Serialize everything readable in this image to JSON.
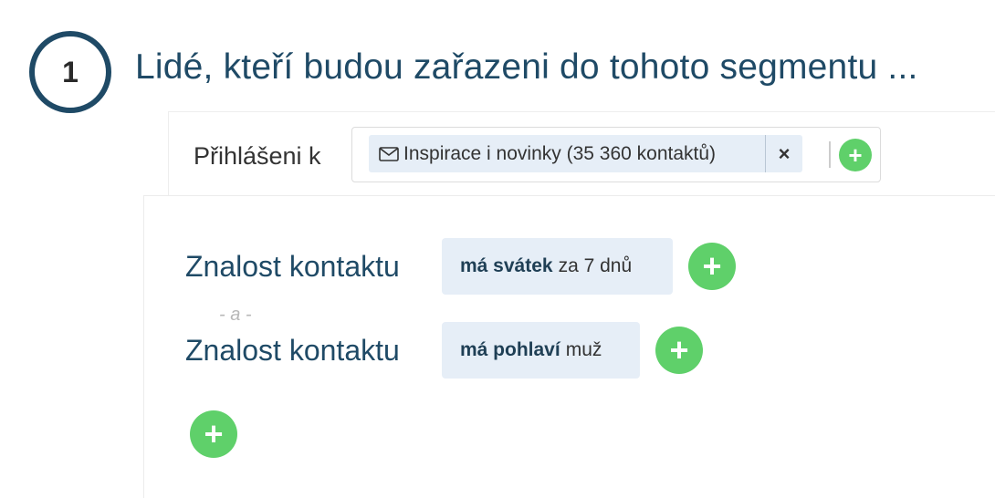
{
  "step": {
    "number": "1",
    "title": "Lidé, kteří budou zařazeni do tohoto segmentu ..."
  },
  "subscription": {
    "label": "Přihlášeni k",
    "tag_text": "Inspirace i novinky (35 360 kontaktů)",
    "tag_icon": "mail-icon",
    "remove_label": "×",
    "add_label": "+"
  },
  "conditions": [
    {
      "label": "Znalost kontaktu",
      "field": "má svátek",
      "value": "za 7 dnů",
      "add_label": "+"
    },
    {
      "label": "Znalost kontaktu",
      "field": "má pohlaví",
      "value": "muž",
      "add_label": "+"
    }
  ],
  "and_separator": "- a -",
  "add_condition_label": "+",
  "colors": {
    "accent_green": "#5fd06a",
    "tag_bg": "#e6eef7",
    "title_blue": "#1f4a66"
  }
}
